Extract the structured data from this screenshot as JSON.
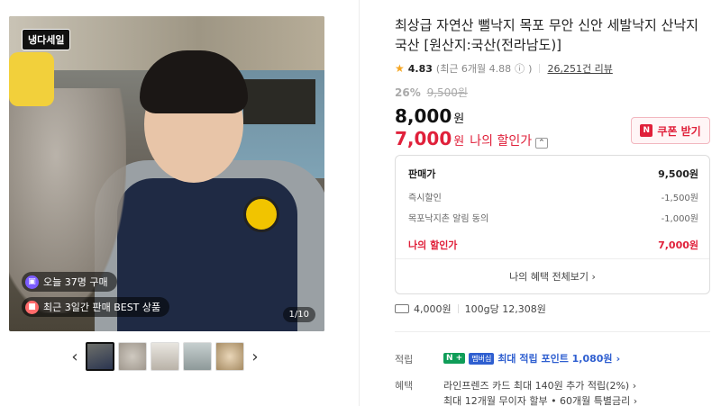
{
  "gallery": {
    "badge": "냉다세일",
    "pills": [
      {
        "icon": "bag-icon",
        "text": "오늘 37명 구매"
      },
      {
        "icon": "gift-icon",
        "text": "최근 3일간 판매 BEST 상품"
      }
    ],
    "counter": "1/10",
    "prev": "‹",
    "next": "›"
  },
  "product": {
    "title": "최상급 자연산 뻘낙지 목포 무안 신안 세발낙지 산낙지 국산 [원산지:국산(전라남도)]",
    "rating": "4.83",
    "recent_rating": "(최근 6개월 4.88",
    "info_mark": "ⓘ",
    "recent_close": ")",
    "review_count": "26,251건 리뷰",
    "discount_pct": "26%",
    "original_price": "9,500원",
    "price": "8,000",
    "price_unit": "원",
    "my_price": "7,000",
    "my_price_unit": "원",
    "my_price_label": "나의 할인가",
    "coupon_label": "쿠폰 받기",
    "coupon_logo": "N"
  },
  "breakdown": {
    "rows": [
      {
        "label": "판매가",
        "value": "9,500원"
      },
      {
        "label": "즉시할인",
        "value": "-1,500원"
      },
      {
        "label": "목포낙지촌 알림 동의",
        "value": "-1,000원"
      }
    ],
    "mine_label": "나의 할인가",
    "mine_value": "7,000원",
    "all_benefits": "나의 혜택 전체보기"
  },
  "shipping": {
    "fee": "4,000원",
    "unit_price": "100g당 12,308원"
  },
  "points": {
    "label": "적립",
    "np": "N +",
    "membership": "멤버십",
    "text": "최대 적립 포인트 1,080원"
  },
  "benefits": {
    "label": "혜택",
    "line1": "라인프렌즈 카드 최대 140원 추가 적립(2%)",
    "line2": "최대 12개월 무이자 할부 • 60개월 특별금리"
  },
  "colors": {
    "accent_red": "#e0203a",
    "point_blue": "#2f5fd0",
    "naver_green": "#0f9d58"
  }
}
